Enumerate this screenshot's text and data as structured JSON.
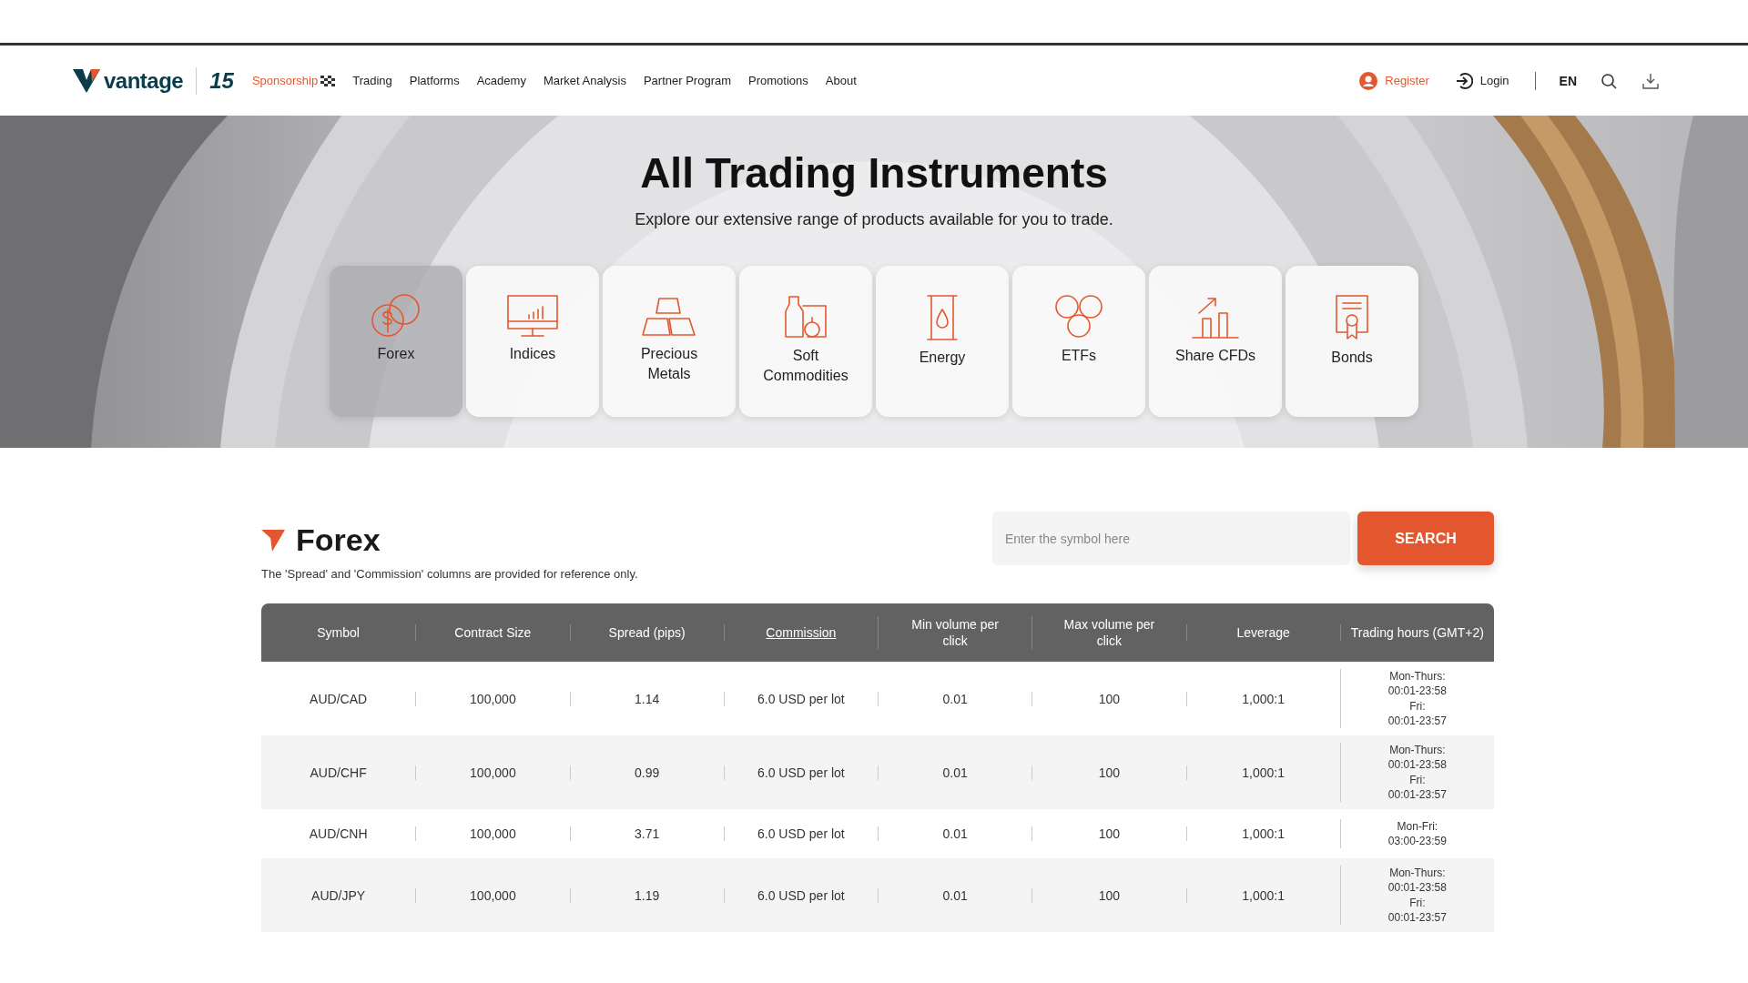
{
  "header": {
    "logo": "vantage",
    "anniversary": "15",
    "nav": [
      {
        "label": "Sponsorship",
        "selected": true
      },
      {
        "label": "Trading",
        "selected": false
      },
      {
        "label": "Platforms",
        "selected": false
      },
      {
        "label": "Academy",
        "selected": false
      },
      {
        "label": "Market Analysis",
        "selected": false
      },
      {
        "label": "Partner Program",
        "selected": false
      },
      {
        "label": "Promotions",
        "selected": false
      },
      {
        "label": "About",
        "selected": false
      }
    ],
    "register": "Register",
    "login": "Login",
    "language": "EN"
  },
  "hero": {
    "title": "All Trading Instruments",
    "subtitle": "Explore our extensive range of products available for you to trade.",
    "categories": [
      {
        "label": "Forex",
        "selected": true
      },
      {
        "label": "Indices",
        "selected": false
      },
      {
        "label": "Precious Metals",
        "selected": false
      },
      {
        "label": "Soft Commodities",
        "selected": false
      },
      {
        "label": "Energy",
        "selected": false
      },
      {
        "label": "ETFs",
        "selected": false
      },
      {
        "label": "Share CFDs",
        "selected": false
      },
      {
        "label": "Bonds",
        "selected": false
      }
    ]
  },
  "section": {
    "title": "Forex",
    "note": "The 'Spread' and 'Commission' columns are provided for reference only.",
    "search": {
      "placeholder": "Enter the symbol here",
      "button": "SEARCH"
    }
  },
  "table": {
    "columns": [
      {
        "label": "Symbol",
        "underlined": false
      },
      {
        "label": "Contract Size",
        "underlined": false
      },
      {
        "label": "Spread (pips)",
        "underlined": false
      },
      {
        "label": "Commission",
        "underlined": true
      },
      {
        "label": "Min volume per click",
        "underlined": false
      },
      {
        "label": "Max volume per click",
        "underlined": false
      },
      {
        "label": "Leverage",
        "underlined": false
      },
      {
        "label": "Trading hours (GMT+2)",
        "underlined": false
      }
    ],
    "rows": [
      [
        "AUD/CAD",
        "100,000",
        "1.14",
        "6.0 USD per lot",
        "0.01",
        "100",
        "1,000:1",
        [
          "Mon-Thurs:",
          "00:01-23:58",
          "Fri:",
          "00:01-23:57"
        ]
      ],
      [
        "AUD/CHF",
        "100,000",
        "0.99",
        "6.0 USD per lot",
        "0.01",
        "100",
        "1,000:1",
        [
          "Mon-Thurs:",
          "00:01-23:58",
          "Fri:",
          "00:01-23:57"
        ]
      ],
      [
        "AUD/CNH",
        "100,000",
        "3.71",
        "6.0 USD per lot",
        "0.01",
        "100",
        "1,000:1",
        [
          "Mon-Fri:",
          "03:00-23:59"
        ]
      ],
      [
        "AUD/JPY",
        "100,000",
        "1.19",
        "6.0 USD per lot",
        "0.01",
        "100",
        "1,000:1",
        [
          "Mon-Thurs:",
          "00:01-23:58",
          "Fri:",
          "00:01-23:57"
        ]
      ]
    ]
  }
}
